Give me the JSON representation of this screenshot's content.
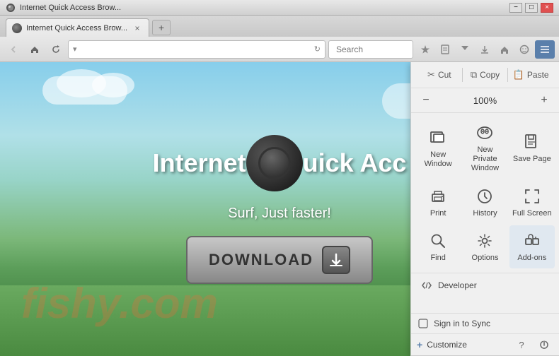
{
  "browser": {
    "title": "Internet Quick Access Brow...",
    "tab_label": "Internet Quick Access Brow...",
    "new_tab_symbol": "+",
    "search_placeholder": "Search"
  },
  "nav": {
    "back_disabled": true,
    "home_icon": "🏠",
    "refresh_icon": "↻"
  },
  "page": {
    "title": "Internet Quick Acc",
    "subtitle": "Surf, Just faster!",
    "download_label": "DOWNLOAD",
    "watermark": "fishy.com"
  },
  "menu": {
    "cut_label": "Cut",
    "copy_label": "Copy",
    "paste_label": "Paste",
    "zoom_level": "100%",
    "items": [
      {
        "id": "new-window",
        "label": "New Window",
        "icon": "window"
      },
      {
        "id": "new-private-window",
        "label": "New Private\nWindow",
        "icon": "mask"
      },
      {
        "id": "save-page",
        "label": "Save Page",
        "icon": "save"
      },
      {
        "id": "print",
        "label": "Print",
        "icon": "print"
      },
      {
        "id": "history",
        "label": "History",
        "icon": "clock"
      },
      {
        "id": "full-screen",
        "label": "Full Screen",
        "icon": "fullscreen"
      },
      {
        "id": "find",
        "label": "Find",
        "icon": "find"
      },
      {
        "id": "options",
        "label": "Options",
        "icon": "gear"
      },
      {
        "id": "add-ons",
        "label": "Add-ons",
        "icon": "puzzle"
      }
    ],
    "developer_label": "Developer",
    "sign_in_label": "Sign in to Sync",
    "customize_label": "Customize",
    "colors": {
      "accent": "#5a7fab",
      "menu_bg": "#f0f0f0",
      "hover": "#e0e8f0"
    }
  }
}
